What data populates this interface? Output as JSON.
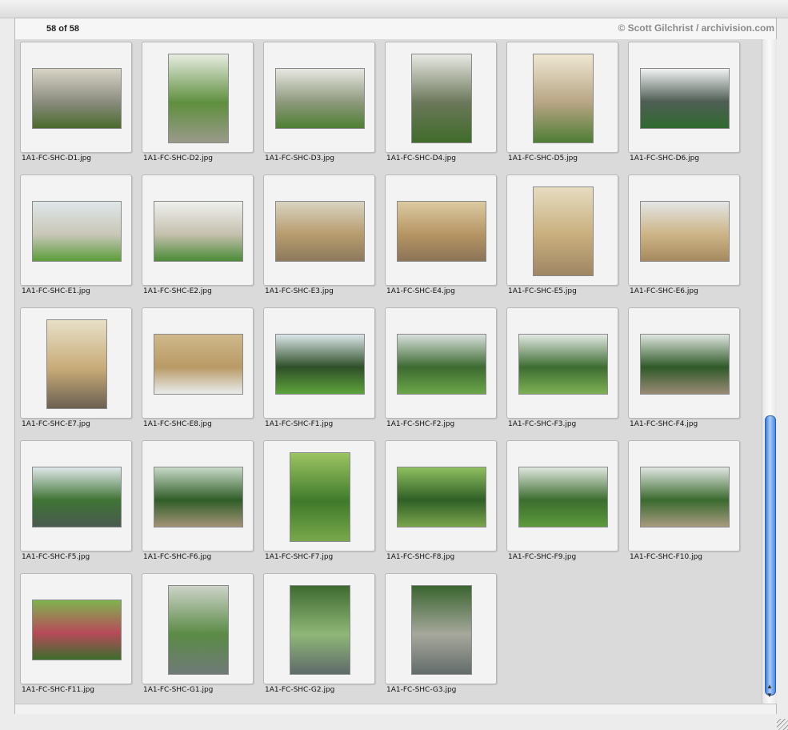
{
  "browser": {
    "counter": "58 of 58",
    "copyright": "© Scott Gilchrist / archivision.com"
  },
  "icons": {
    "scroll_up": "scroll-up-arrow-icon",
    "scroll_down": "scroll-down-arrow-icon",
    "resize": "resize-grip-icon"
  },
  "thumbnails": [
    {
      "filename": "1A1-FC-SHC-D1.jpg",
      "orientation": "landscape",
      "colors": [
        "#d8d4c6",
        "#8c8d80",
        "#4a6b2b"
      ]
    },
    {
      "filename": "1A1-FC-SHC-D2.jpg",
      "orientation": "portrait",
      "colors": [
        "#e6ece0",
        "#5e8f3e",
        "#9b9a8a"
      ]
    },
    {
      "filename": "1A1-FC-SHC-D3.jpg",
      "orientation": "landscape",
      "colors": [
        "#e8e8e2",
        "#8f9a7e",
        "#4d7f32"
      ]
    },
    {
      "filename": "1A1-FC-SHC-D4.jpg",
      "orientation": "portrait",
      "colors": [
        "#e8e9e4",
        "#6b7759",
        "#3f6c2a"
      ]
    },
    {
      "filename": "1A1-FC-SHC-D5.jpg",
      "orientation": "portrait",
      "colors": [
        "#efe7d3",
        "#b7a584",
        "#4f7d35"
      ]
    },
    {
      "filename": "1A1-FC-SHC-D6.jpg",
      "orientation": "landscape",
      "colors": [
        "#f1f3f3",
        "#4f5e55",
        "#2f6a2f"
      ]
    },
    {
      "filename": "1A1-FC-SHC-E1.jpg",
      "orientation": "landscape",
      "colors": [
        "#dfe6e9",
        "#c9c7b8",
        "#5b9d3b"
      ]
    },
    {
      "filename": "1A1-FC-SHC-E2.jpg",
      "orientation": "landscape",
      "colors": [
        "#eef0ee",
        "#c6c0ae",
        "#4a8b36"
      ]
    },
    {
      "filename": "1A1-FC-SHC-E3.jpg",
      "orientation": "landscape",
      "colors": [
        "#d9d4c2",
        "#b79c6e",
        "#8d7a5c"
      ]
    },
    {
      "filename": "1A1-FC-SHC-E4.jpg",
      "orientation": "landscape",
      "colors": [
        "#dccaa2",
        "#b69564",
        "#8b7457"
      ]
    },
    {
      "filename": "1A1-FC-SHC-E5.jpg",
      "orientation": "portrait",
      "colors": [
        "#e6dcc1",
        "#c8ae7c",
        "#9f8665"
      ]
    },
    {
      "filename": "1A1-FC-SHC-E6.jpg",
      "orientation": "landscape",
      "colors": [
        "#e3e6e6",
        "#cdb486",
        "#a58a5f"
      ]
    },
    {
      "filename": "1A1-FC-SHC-E7.jpg",
      "orientation": "portrait",
      "colors": [
        "#e8e0c8",
        "#c8ab77",
        "#6b6052"
      ]
    },
    {
      "filename": "1A1-FC-SHC-E8.jpg",
      "orientation": "landscape",
      "colors": [
        "#cfb88a",
        "#b99a66",
        "#e8ecec"
      ]
    },
    {
      "filename": "1A1-FC-SHC-F1.jpg",
      "orientation": "landscape",
      "colors": [
        "#dbe6ea",
        "#2f4f28",
        "#5da33b"
      ]
    },
    {
      "filename": "1A1-FC-SHC-F2.jpg",
      "orientation": "landscape",
      "colors": [
        "#d8dfdc",
        "#3d6a31",
        "#6aa648"
      ]
    },
    {
      "filename": "1A1-FC-SHC-F3.jpg",
      "orientation": "landscape",
      "colors": [
        "#e3e8e4",
        "#3c6d31",
        "#7eb055"
      ]
    },
    {
      "filename": "1A1-FC-SHC-F4.jpg",
      "orientation": "landscape",
      "colors": [
        "#dfe5df",
        "#2f5a28",
        "#9a8a76"
      ]
    },
    {
      "filename": "1A1-FC-SHC-F5.jpg",
      "orientation": "landscape",
      "colors": [
        "#dfe7ea",
        "#3f7435",
        "#4a5a50"
      ]
    },
    {
      "filename": "1A1-FC-SHC-F6.jpg",
      "orientation": "landscape",
      "colors": [
        "#c7d9c7",
        "#2f5d27",
        "#a39377"
      ]
    },
    {
      "filename": "1A1-FC-SHC-F7.jpg",
      "orientation": "portrait",
      "colors": [
        "#9cc463",
        "#3f7a2a",
        "#79a84b"
      ]
    },
    {
      "filename": "1A1-FC-SHC-F8.jpg",
      "orientation": "landscape",
      "colors": [
        "#8fbf5f",
        "#2f5f26",
        "#7aa54c"
      ]
    },
    {
      "filename": "1A1-FC-SHC-F9.jpg",
      "orientation": "landscape",
      "colors": [
        "#dfe6de",
        "#3c6d2f",
        "#5c9a3c"
      ]
    },
    {
      "filename": "1A1-FC-SHC-F10.jpg",
      "orientation": "landscape",
      "colors": [
        "#e0e6e2",
        "#3a6a2e",
        "#a89a80"
      ]
    },
    {
      "filename": "1A1-FC-SHC-F11.jpg",
      "orientation": "landscape",
      "colors": [
        "#7fb34f",
        "#b84a5a",
        "#3c6d2c"
      ]
    },
    {
      "filename": "1A1-FC-SHC-G1.jpg",
      "orientation": "portrait",
      "colors": [
        "#cdd3c8",
        "#5a8b45",
        "#6f7a78"
      ]
    },
    {
      "filename": "1A1-FC-SHC-G2.jpg",
      "orientation": "portrait",
      "colors": [
        "#3e6a31",
        "#8fb777",
        "#5f6a6a"
      ]
    },
    {
      "filename": "1A1-FC-SHC-G3.jpg",
      "orientation": "portrait",
      "colors": [
        "#3a6530",
        "#a7a89c",
        "#636c6a"
      ]
    }
  ]
}
